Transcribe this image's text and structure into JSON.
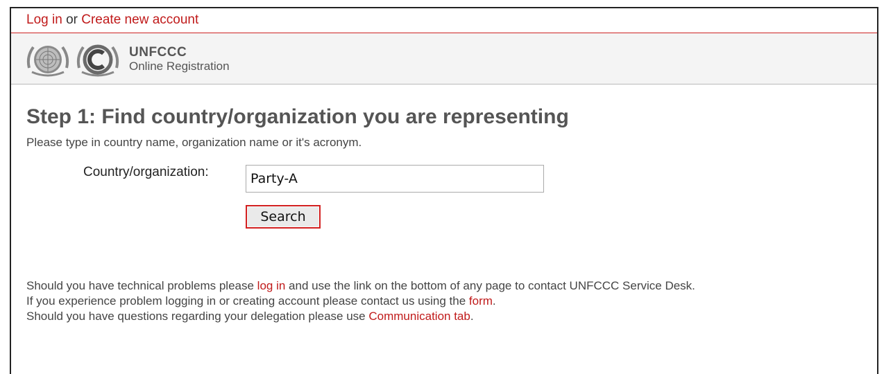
{
  "topbar": {
    "login_link": "Log in",
    "separator": "or",
    "create_link": "Create new account"
  },
  "brand": {
    "name": "UNFCCC",
    "subtitle": "Online Registration"
  },
  "page": {
    "title": "Step 1: Find country/organization you are representing",
    "intro": "Please type in country name, organization name or it's acronym."
  },
  "form": {
    "country_label": "Country/organization:",
    "country_value": "Party-A",
    "search_label": "Search"
  },
  "help": {
    "line1_pre": "Should you have technical problems please",
    "line1_link": "log in",
    "line1_post": "and use the link on the bottom of any page to contact UNFCCC Service Desk.",
    "line2_pre": "If you experience problem logging in or creating account please contact us using the",
    "line2_link": "form",
    "line2_post": ".",
    "line3_pre": "Should you have questions regarding your delegation please use",
    "line3_link": "Communication tab",
    "line3_post": "."
  },
  "colors": {
    "link": "#c01a1a",
    "highlight_border": "#d32020"
  }
}
